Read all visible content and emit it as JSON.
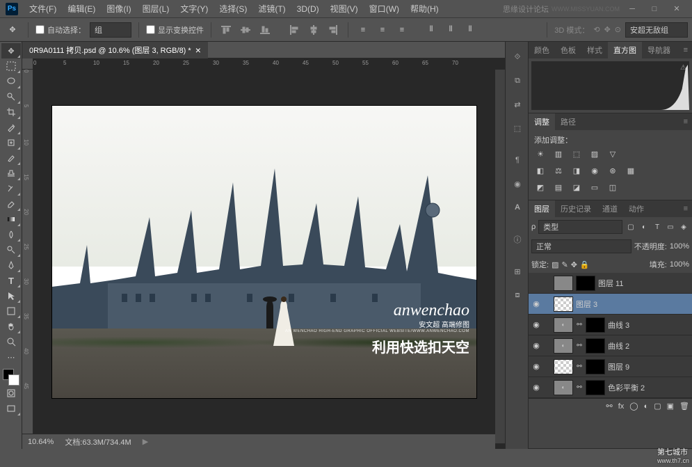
{
  "menu": [
    "文件(F)",
    "编辑(E)",
    "图像(I)",
    "图层(L)",
    "文字(Y)",
    "选择(S)",
    "滤镜(T)",
    "3D(D)",
    "视图(V)",
    "窗口(W)",
    "帮助(H)"
  ],
  "titlebar_brand": "思缘设计论坛",
  "options": {
    "auto_select": "自动选择：",
    "auto_select_val": "组",
    "show_transform": "显示变换控件",
    "d3_mode": "3D 模式：",
    "d3_val": "安超无敌组"
  },
  "doc": {
    "tab": "0R9A0111 拷贝.psd @ 10.6% (图层 3, RGB/8) *"
  },
  "ruler_h": [
    "0",
    "5",
    "10",
    "15",
    "20",
    "25",
    "30",
    "35",
    "40",
    "45",
    "50",
    "55",
    "60",
    "65",
    "70"
  ],
  "ruler_v": [
    "0",
    "5",
    "10",
    "15",
    "20",
    "25",
    "30",
    "35",
    "40",
    "45"
  ],
  "watermark": {
    "script": "anwenchao",
    "cn": "安文超 高端修图",
    "sub": "AN WENCHAO HIGH-END GRAPHIC OFFICIAL WEBSITE/WWW.ANWENCHAO.COM",
    "big": "利用快选扣天空"
  },
  "status": {
    "zoom": "10.64%",
    "doc": "文档:63.3M/734.4M"
  },
  "panel_histogram": {
    "tabs": [
      "颜色",
      "色板",
      "样式",
      "直方图",
      "导航器"
    ],
    "active": 3
  },
  "panel_adjust": {
    "tabs": [
      "调整",
      "路径"
    ],
    "active": 0,
    "label": "添加调整："
  },
  "panel_layers": {
    "tabs": [
      "图层",
      "历史记录",
      "通道",
      "动作"
    ],
    "active": 0,
    "filter": "类型",
    "blend": "正常",
    "opacity_l": "不透明度:",
    "opacity_v": "100%",
    "lock_l": "锁定:",
    "fill_l": "填充:",
    "fill_v": "100%",
    "rows": [
      {
        "eye": "",
        "name": "图层 11",
        "thumb": "img",
        "mask": true
      },
      {
        "eye": "◉",
        "name": "图层 3",
        "thumb": "chk",
        "mask": false,
        "sel": true
      },
      {
        "eye": "◉",
        "name": "曲线 3",
        "thumb": "adj",
        "mask": true,
        "link": true
      },
      {
        "eye": "◉",
        "name": "曲线 2",
        "thumb": "adj",
        "mask": true,
        "link": true
      },
      {
        "eye": "◉",
        "name": "图层 9",
        "thumb": "chk",
        "mask": true,
        "link": true
      },
      {
        "eye": "◉",
        "name": "色彩平衡 2",
        "thumb": "adj",
        "mask": true,
        "link": true
      }
    ]
  },
  "site_wm": "第七城市",
  "site_url": "www.th7.cn"
}
